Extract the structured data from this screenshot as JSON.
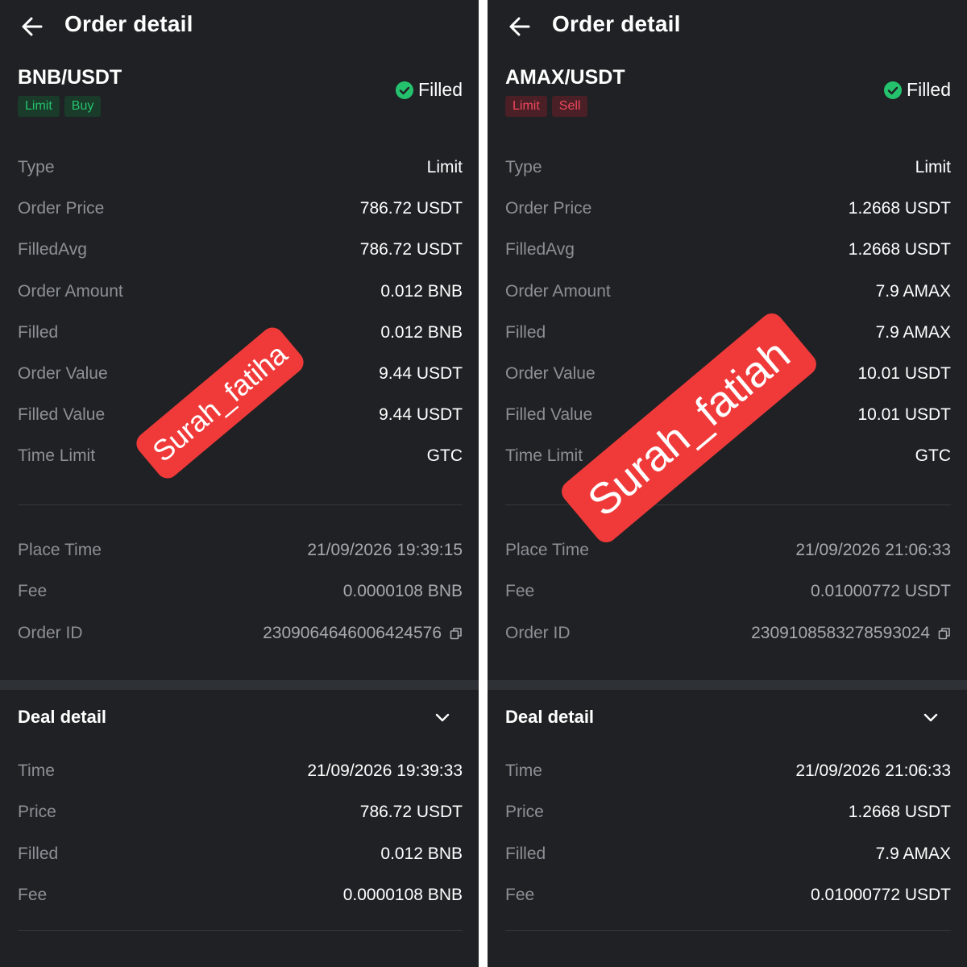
{
  "left": {
    "header": {
      "title": "Order detail"
    },
    "pair": "BNB/USDT",
    "tags": [
      "Limit",
      "Buy"
    ],
    "status": "Filled",
    "details": [
      {
        "label": "Type",
        "value": "Limit"
      },
      {
        "label": "Order Price",
        "value": "786.72 USDT"
      },
      {
        "label": "FilledAvg",
        "value": "786.72 USDT"
      },
      {
        "label": "Order Amount",
        "value": "0.012 BNB"
      },
      {
        "label": "Filled",
        "value": "0.012 BNB"
      },
      {
        "label": "Order Value",
        "value": "9.44 USDT"
      },
      {
        "label": "Filled Value",
        "value": "9.44 USDT"
      },
      {
        "label": "Time Limit",
        "value": "GTC"
      }
    ],
    "meta": [
      {
        "label": "Place Time",
        "value": "21/09/2026 19:39:15"
      },
      {
        "label": "Fee",
        "value": "0.0000108 BNB"
      },
      {
        "label": "Order ID",
        "value": "2309064646006424576"
      }
    ],
    "deal": {
      "title": "Deal detail",
      "rows": [
        {
          "label": "Time",
          "value": "21/09/2026 19:39:33"
        },
        {
          "label": "Price",
          "value": "786.72 USDT"
        },
        {
          "label": "Filled",
          "value": "0.012 BNB"
        },
        {
          "label": "Fee",
          "value": "0.0000108 BNB"
        }
      ]
    },
    "watermark": "Surah_fatiha"
  },
  "right": {
    "header": {
      "title": "Order detail"
    },
    "pair": "AMAX/USDT",
    "tags": [
      "Limit",
      "Sell"
    ],
    "status": "Filled",
    "details": [
      {
        "label": "Type",
        "value": "Limit"
      },
      {
        "label": "Order Price",
        "value": "1.2668 USDT"
      },
      {
        "label": "FilledAvg",
        "value": "1.2668 USDT"
      },
      {
        "label": "Order Amount",
        "value": "7.9 AMAX"
      },
      {
        "label": "Filled",
        "value": "7.9 AMAX"
      },
      {
        "label": "Order Value",
        "value": "10.01 USDT"
      },
      {
        "label": "Filled Value",
        "value": "10.01 USDT"
      },
      {
        "label": "Time Limit",
        "value": "GTC"
      }
    ],
    "meta": [
      {
        "label": "Place Time",
        "value": "21/09/2026 21:06:33"
      },
      {
        "label": "Fee",
        "value": "0.01000772 USDT"
      },
      {
        "label": "Order ID",
        "value": "2309108583278593024"
      }
    ],
    "deal": {
      "title": "Deal detail",
      "rows": [
        {
          "label": "Time",
          "value": "21/09/2026 21:06:33"
        },
        {
          "label": "Price",
          "value": "1.2668 USDT"
        },
        {
          "label": "Filled",
          "value": "7.9 AMAX"
        },
        {
          "label": "Fee",
          "value": "0.01000772 USDT"
        }
      ]
    },
    "watermark": "Surah_fatiah"
  },
  "colors": {
    "background": "#1f2124",
    "buy": "#25c26e",
    "sell": "#f0485c",
    "filled_check": "#25c26e",
    "watermark": "#f03a3a"
  },
  "icons": [
    "back-arrow-icon",
    "check-circle-icon",
    "copy-icon",
    "chevron-down-icon"
  ]
}
